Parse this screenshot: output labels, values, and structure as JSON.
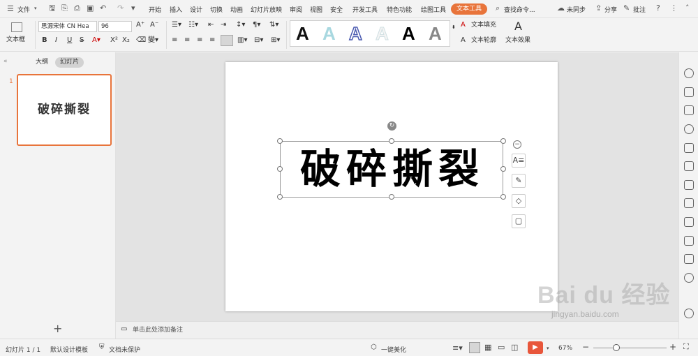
{
  "menu": {
    "file_label": "文件",
    "tabs": [
      "开始",
      "插入",
      "设计",
      "切换",
      "动画",
      "幻灯片放映",
      "审阅",
      "视图",
      "安全",
      "开发工具",
      "特色功能",
      "绘图工具",
      "文本工具"
    ],
    "search": "查找命令...",
    "sync": "未同步",
    "share": "分享",
    "comment": "批注"
  },
  "ribbon": {
    "textbox_label": "文本框",
    "font_name": "思源宋体 CN Hea",
    "font_size": "96",
    "text_fill": "文本填充",
    "text_outline": "文本轮廓",
    "text_effects": "文本效果",
    "style_glyph": "A"
  },
  "left_panel": {
    "outline_tab": "大纲",
    "slides_tab": "幻灯片",
    "slide_number": "1",
    "thumb_text": "破碎撕裂"
  },
  "slide": {
    "text": "破碎撕裂"
  },
  "notes": {
    "placeholder": "单击此处添加备注"
  },
  "status": {
    "slide_info": "幻灯片 1 / 1",
    "template": "默认设计模板",
    "protection": "文档未保护",
    "beautify": "一键美化",
    "zoom": "67%"
  },
  "watermark": {
    "logo": "Bai du 经验",
    "url": "jingyan.baidu.com"
  },
  "colors": {
    "accent": "#e8743b",
    "play": "#e8563b"
  }
}
